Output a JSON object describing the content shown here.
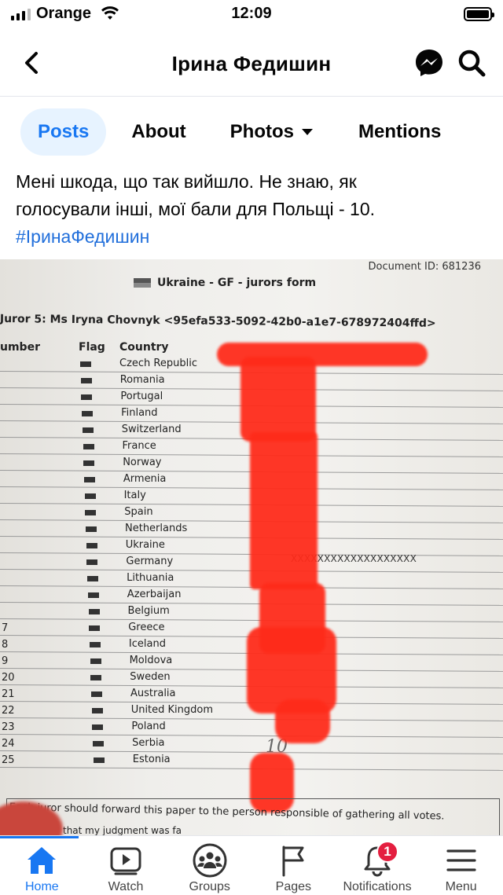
{
  "status_bar": {
    "carrier": "Orange",
    "time": "12:09"
  },
  "header": {
    "title": "Ірина Федишин",
    "icons": [
      "back-icon",
      "messenger-icon",
      "search-icon"
    ]
  },
  "tabs": [
    {
      "label": "Posts",
      "active": true
    },
    {
      "label": "About",
      "active": false
    },
    {
      "label": "Photos",
      "active": false
    },
    {
      "label": "Mentions",
      "active": false
    }
  ],
  "post": {
    "text_line1": "Мені шкода, що так вийшло. Не знаю, як",
    "text_line2": "голосували інші, мої бали для Польщі - 10.",
    "hashtag": "#ІринаФедишин"
  },
  "document": {
    "doc_id": "Document ID: 681236",
    "form_title": "Ukraine - GF - jurors form",
    "juror": "Juror 5: Ms Iryna Chovnyk <95efa533-5092-42b0-a1e7-678972404ffd>",
    "col_number": "umber",
    "col_flag": "Flag",
    "col_country": "Country",
    "rows": [
      {
        "num": "",
        "country": "Czech Republic"
      },
      {
        "num": "",
        "country": "Romania"
      },
      {
        "num": "",
        "country": "Portugal"
      },
      {
        "num": "",
        "country": "Finland"
      },
      {
        "num": "",
        "country": "Switzerland"
      },
      {
        "num": "",
        "country": "France"
      },
      {
        "num": "",
        "country": "Norway"
      },
      {
        "num": "",
        "country": "Armenia"
      },
      {
        "num": "",
        "country": "Italy"
      },
      {
        "num": "",
        "country": "Spain"
      },
      {
        "num": "",
        "country": "Netherlands"
      },
      {
        "num": "",
        "country": "Ukraine"
      },
      {
        "num": "",
        "country": "Germany"
      },
      {
        "num": "",
        "country": "Lithuania"
      },
      {
        "num": "",
        "country": "Azerbaijan"
      },
      {
        "num": "",
        "country": "Belgium"
      },
      {
        "num": "7",
        "country": "Greece"
      },
      {
        "num": "8",
        "country": "Iceland"
      },
      {
        "num": "9",
        "country": "Moldova"
      },
      {
        "num": "20",
        "country": "Sweden"
      },
      {
        "num": "21",
        "country": "Australia"
      },
      {
        "num": "22",
        "country": "United Kingdom"
      },
      {
        "num": "23",
        "country": "Poland"
      },
      {
        "num": "24",
        "country": "Serbia"
      },
      {
        "num": "25",
        "country": "Estonia"
      }
    ],
    "ukraine_mark": "XXXXXXXXXXXXXXXXXXX",
    "handwritten": "10",
    "footer_line1": "Each juror should forward this paper to the person responsible of gathering all votes.",
    "footer_line2": "that my judgment was fa"
  },
  "bottom_nav": [
    {
      "label": "Home",
      "icon": "home-icon",
      "active": true
    },
    {
      "label": "Watch",
      "icon": "watch-icon",
      "active": false
    },
    {
      "label": "Groups",
      "icon": "groups-icon",
      "active": false
    },
    {
      "label": "Pages",
      "icon": "pages-icon",
      "active": false
    },
    {
      "label": "Notifications",
      "icon": "bell-icon",
      "active": false,
      "badge": "1"
    },
    {
      "label": "Menu",
      "icon": "menu-icon",
      "active": false
    }
  ],
  "colors": {
    "accent": "#1877f2",
    "badge": "#e41e3f",
    "redaction": "#ff2b1a"
  }
}
